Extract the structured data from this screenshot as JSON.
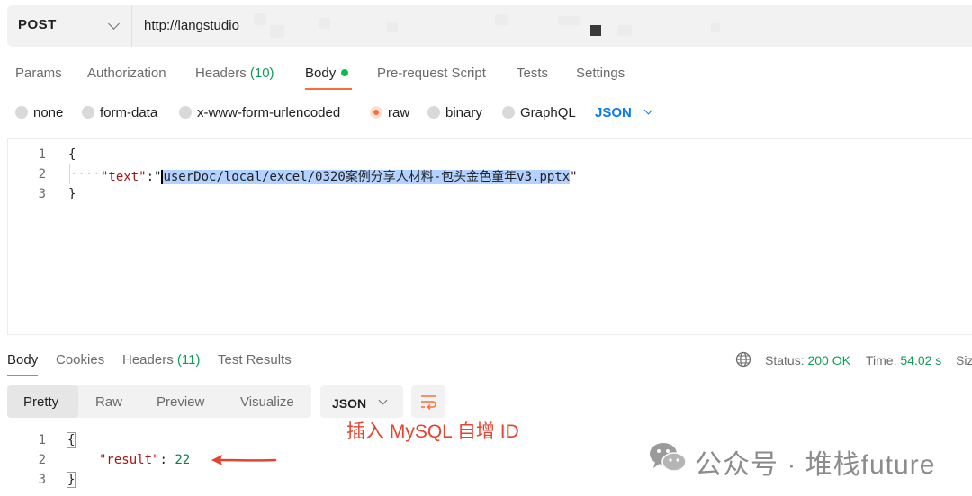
{
  "request": {
    "method": "POST",
    "url": "http://langstudio"
  },
  "request_tabs": [
    {
      "label": "Params"
    },
    {
      "label": "Authorization"
    },
    {
      "label": "Headers",
      "count": "(10)"
    },
    {
      "label": "Body"
    },
    {
      "label": "Pre-request Script"
    },
    {
      "label": "Tests"
    },
    {
      "label": "Settings"
    }
  ],
  "body_types": [
    "none",
    "form-data",
    "x-www-form-urlencoded",
    "raw",
    "binary",
    "GraphQL"
  ],
  "body_selected": "raw",
  "body_format": "JSON",
  "request_body": {
    "line_numbers": [
      "1",
      "2",
      "3"
    ],
    "open_brace": "{",
    "key": "\"text\"",
    "colon": ":",
    "quote_open": "\"",
    "value": "userDoc/local/excel/0320案例分享人材料-包头金色童年v3.pptx",
    "quote_close": "\"",
    "close_brace": "}"
  },
  "response_tabs": [
    {
      "label": "Body"
    },
    {
      "label": "Cookies"
    },
    {
      "label": "Headers",
      "count": "(11)"
    },
    {
      "label": "Test Results"
    }
  ],
  "response_status": {
    "status_label": "Status:",
    "status_value": "200 OK",
    "time_label": "Time:",
    "time_value": "54.02 s",
    "size_label": "Siz"
  },
  "view_modes": [
    "Pretty",
    "Raw",
    "Preview",
    "Visualize"
  ],
  "view_selected": "Pretty",
  "response_format": "JSON",
  "response_body": {
    "line_numbers": [
      "1",
      "2",
      "3"
    ],
    "open_brace": "{",
    "key": "\"result\"",
    "colon": ":",
    "value": "22",
    "close_brace": "}"
  },
  "annotation": "插入 MySQL 自增 ID",
  "watermark": "公众号 · 堆栈future",
  "colors": {
    "accent": "#ff6c37",
    "status_green": "#0f9d58",
    "annotation_red": "#e5432f",
    "json_blue": "#097bed"
  },
  "icons": [
    "chevron-down-icon",
    "globe-icon",
    "wrap-lines-icon",
    "arrow-icon",
    "wechat-icon"
  ]
}
